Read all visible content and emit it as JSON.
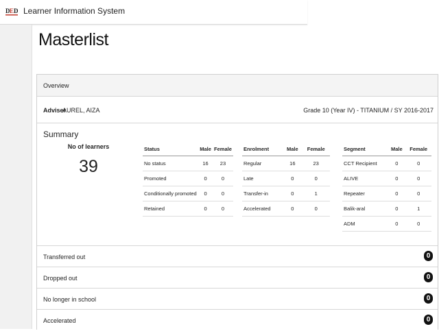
{
  "app": {
    "title": "Learner Information System",
    "logo_icon": "deped-logo"
  },
  "page": {
    "title": "Masterlist"
  },
  "panel": {
    "heading": "Overview",
    "adviser_label": "Adviser",
    "adviser_name": "AUREL, AIZA",
    "grade_info": "Grade 10 (Year IV) - TITANIUM / SY 2016-2017"
  },
  "summary": {
    "title": "Summary",
    "learners_label": "No of learners",
    "learners_count": "39",
    "status_table": {
      "headers": [
        "Status",
        "Male",
        "Female"
      ],
      "rows": [
        [
          "No status",
          "16",
          "23"
        ],
        [
          "Promoted",
          "0",
          "0"
        ],
        [
          "Conditionally promoted",
          "0",
          "0"
        ],
        [
          "Retained",
          "0",
          "0"
        ]
      ]
    },
    "enrolment_table": {
      "headers": [
        "Enrolment",
        "Male",
        "Female"
      ],
      "rows": [
        [
          "Regular",
          "16",
          "23"
        ],
        [
          "Late",
          "0",
          "0"
        ],
        [
          "Transfer-in",
          "0",
          "1"
        ],
        [
          "Accelerated",
          "0",
          "0"
        ]
      ]
    },
    "segment_table": {
      "headers": [
        "Segment",
        "Male",
        "Female"
      ],
      "rows": [
        [
          "CCT Recipient",
          "0",
          "0"
        ],
        [
          "ALIVE",
          "0",
          "0"
        ],
        [
          "Repeater",
          "0",
          "0"
        ],
        [
          "Balik-aral",
          "0",
          "1"
        ],
        [
          "ADM",
          "0",
          "0"
        ]
      ]
    }
  },
  "lists": [
    {
      "label": "Transferred out",
      "count": "0"
    },
    {
      "label": "Dropped out",
      "count": "0"
    },
    {
      "label": "No longer in school",
      "count": "0"
    },
    {
      "label": "Accelerated",
      "count": "0"
    }
  ]
}
